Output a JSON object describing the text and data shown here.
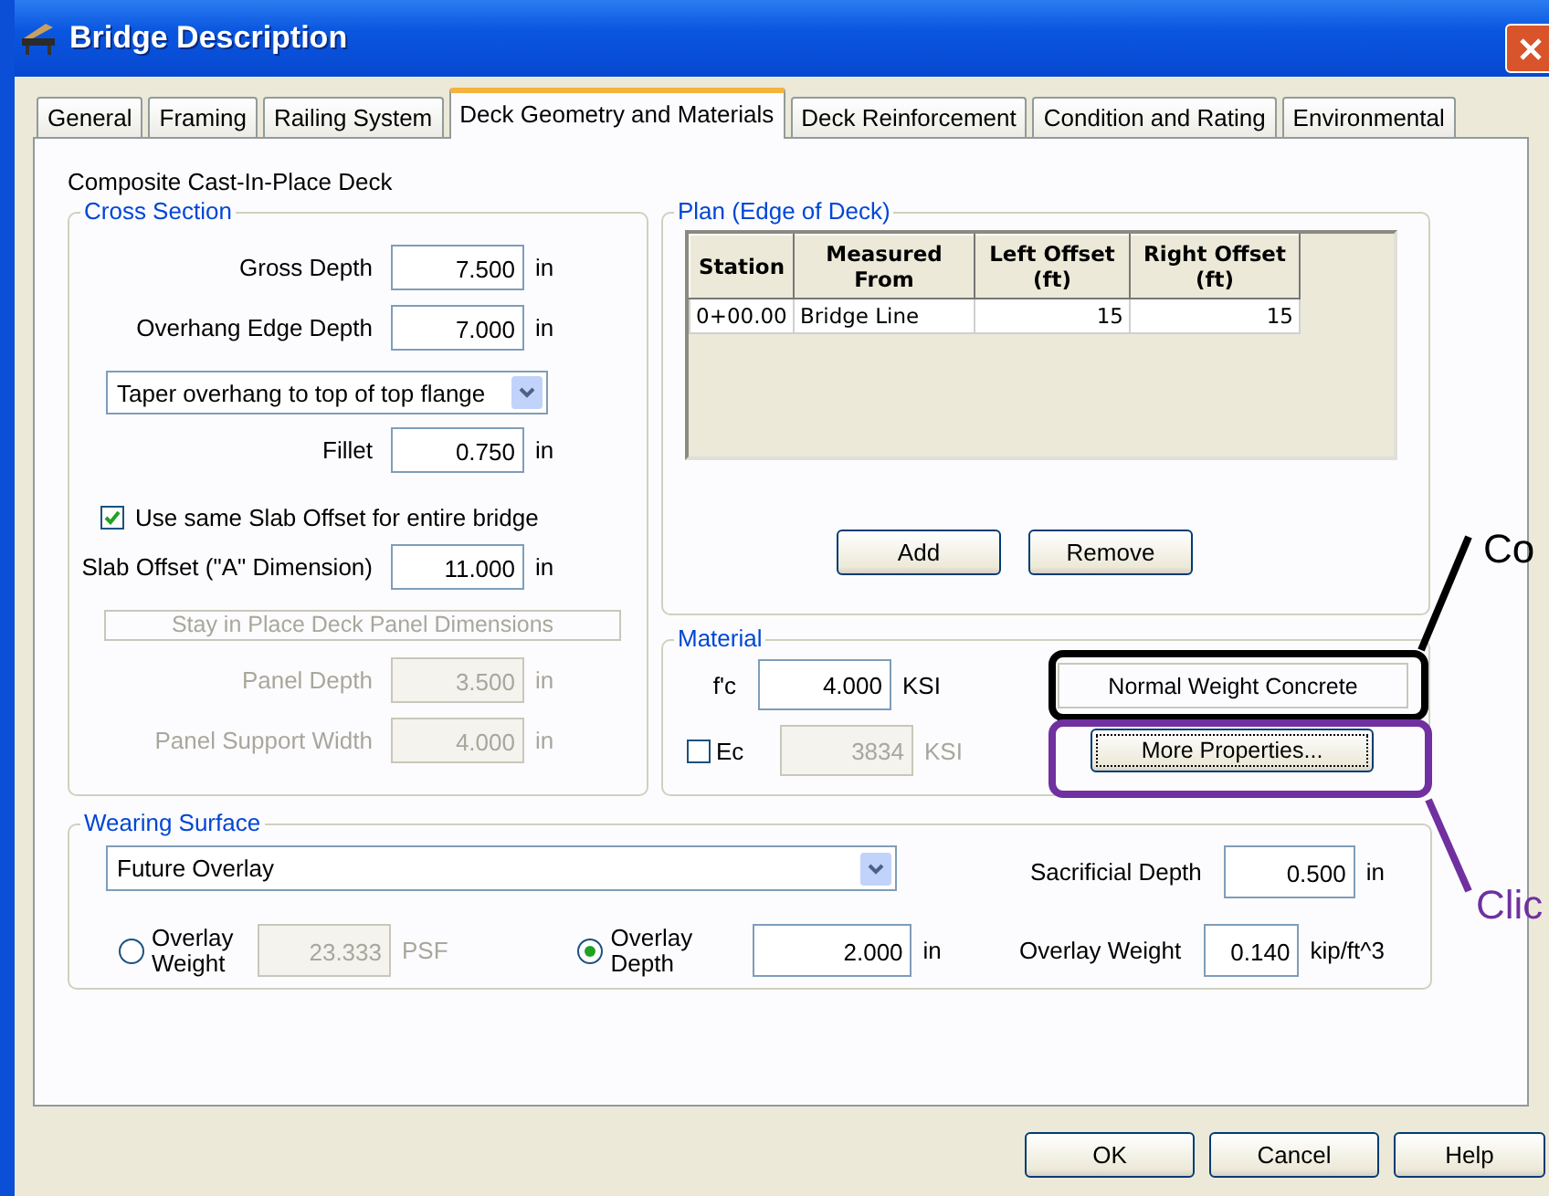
{
  "window": {
    "title": "Bridge Description"
  },
  "tabs": [
    {
      "label": "General",
      "selected": false
    },
    {
      "label": "Framing",
      "selected": false
    },
    {
      "label": "Railing System",
      "selected": false
    },
    {
      "label": "Deck Geometry and Materials",
      "selected": true
    },
    {
      "label": "Deck Reinforcement",
      "selected": false
    },
    {
      "label": "Condition and Rating",
      "selected": false
    },
    {
      "label": "Environmental",
      "selected": false
    }
  ],
  "deck_type": "Composite Cast-In-Place Deck",
  "cross_section": {
    "title": "Cross Section",
    "rows": [
      {
        "kind": "number",
        "label": "Gross Depth",
        "value": "7.500",
        "unit": "in",
        "disabled": false
      },
      {
        "kind": "number",
        "label": "Overhang Edge Depth",
        "value": "7.000",
        "unit": "in",
        "disabled": false
      },
      {
        "kind": "select",
        "value": "Taper overhang to top of top flange"
      },
      {
        "kind": "number",
        "label": "Fillet",
        "value": "0.750",
        "unit": "in",
        "disabled": false
      },
      {
        "kind": "checkbox",
        "label": "Use same Slab Offset for entire bridge",
        "checked": true
      },
      {
        "kind": "number",
        "label": "Slab Offset (\"A\" Dimension)",
        "value": "11.000",
        "unit": "in",
        "disabled": false
      },
      {
        "kind": "header",
        "label": "Stay in Place Deck Panel Dimensions",
        "disabled": true
      },
      {
        "kind": "number",
        "label": "Panel Depth",
        "value": "3.500",
        "unit": "in",
        "disabled": true
      },
      {
        "kind": "number",
        "label": "Panel Support Width",
        "value": "4.000",
        "unit": "in",
        "disabled": true
      }
    ]
  },
  "plan": {
    "title": "Plan (Edge of Deck)",
    "columns": [
      "Station",
      "Measured From",
      "Left Offset (ft)",
      "Right Offset (ft)"
    ],
    "rows": [
      [
        "0+00.00",
        "Bridge Line",
        "15",
        "15"
      ]
    ],
    "buttons": [
      "Add",
      "Remove"
    ]
  },
  "material": {
    "title": "Material",
    "fc": {
      "label": "f'c",
      "value": "4.000",
      "unit": "KSI"
    },
    "ec": {
      "label": "Ec",
      "checked": false,
      "value": "3834",
      "unit": "KSI"
    },
    "concrete_type": "Normal Weight Concrete",
    "more_button": {
      "label": "More Properties...",
      "focused": true
    }
  },
  "wearing_surface": {
    "title": "Wearing Surface",
    "type": "Future Overlay",
    "sacrificial_depth": {
      "label": "Sacrificial Depth",
      "value": "0.500",
      "unit": "in"
    },
    "overlay_weight_option": {
      "label": "Overlay Weight",
      "selected": false,
      "value": "23.333",
      "unit": "PSF"
    },
    "overlay_depth_option": {
      "label": "Overlay Depth",
      "selected": true,
      "value": "2.000",
      "unit": "in"
    },
    "overlay_weight": {
      "label": "Overlay Weight",
      "value": "0.140",
      "unit": "kip/ft^3"
    }
  },
  "buttons": [
    "OK",
    "Cancel",
    "Help"
  ],
  "annotations": [
    {
      "text": "Co",
      "color": "#000000"
    },
    {
      "text": "Clic",
      "color": "#7030a0"
    }
  ]
}
